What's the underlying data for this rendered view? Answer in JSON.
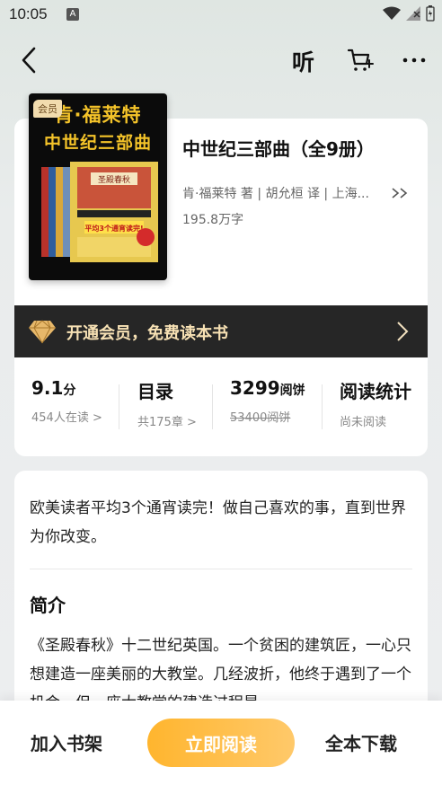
{
  "status_bar": {
    "time": "10:05",
    "notif_letter": "A"
  },
  "nav": {
    "listen_label": "听"
  },
  "book": {
    "vip_badge": "会员",
    "cover_title_line1": "肯·福莱特",
    "cover_title_line2": "中世纪三部曲",
    "title": "中世纪三部曲（全9册）",
    "author_line": "肯·福莱特 著 | 胡允桓 译 | 上海...",
    "word_count": "195.8万字"
  },
  "vip_banner": {
    "text": "开通会员，免费读本书"
  },
  "stats": [
    {
      "main": "9.1",
      "unit": "分",
      "sub": "454人在读 >"
    },
    {
      "main": "目录",
      "unit": "",
      "sub": "共175章 >"
    },
    {
      "main": "3299",
      "unit": "阅饼",
      "sub": "53400阅饼"
    },
    {
      "main": "阅读统计",
      "unit": "",
      "sub": "尚未阅读"
    }
  ],
  "intro": {
    "tagline": "欧美读者平均3个通宵读完！做自己喜欢的事，直到世界为你改变。",
    "title": "简介",
    "body": "《圣殿春秋》十二世纪英国。一个贫困的建筑匠，一心只想建造一座美丽的大教堂。几经波折，他终于遇到了一个机会，但一座大教堂的建造过程是一"
  },
  "actions": {
    "add_shelf": "加入书架",
    "read_now": "立即阅读",
    "download_all": "全本下载"
  },
  "colors": {
    "accent": "#ffb52e",
    "vip_gold": "#f7e1b4",
    "vip_bg": "#262626"
  }
}
